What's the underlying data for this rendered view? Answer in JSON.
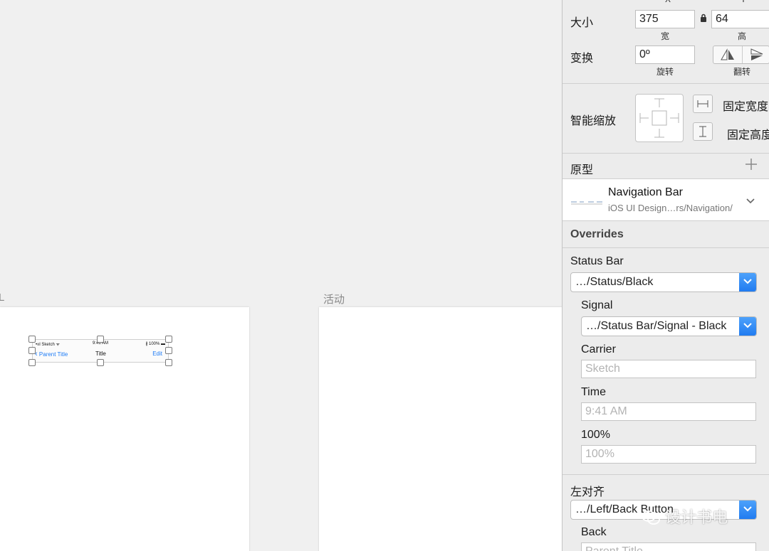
{
  "canvas": {
    "artboard_right_label": "活动",
    "artboard_left_label": "L",
    "navbar": {
      "status_left": "•ııl Sketch ᯤ",
      "status_time": "9:41 AM",
      "status_right": "∦ 100% ▬",
      "back_label": "Parent Title",
      "title": "Title",
      "edit_label": "Edit"
    }
  },
  "inspector": {
    "size": {
      "label": "大小",
      "width_value": "375",
      "width_caption": "宽",
      "height_value": "64",
      "height_caption": "高",
      "top_caption_x": "X",
      "top_caption_y": "Y"
    },
    "transform": {
      "label": "变换",
      "rotate_value": "0º",
      "rotate_caption": "旋转",
      "flip_caption": "翻转"
    },
    "resizing": {
      "label": "智能缩放",
      "fix_width_label": "固定宽度",
      "fix_height_label": "固定高度"
    },
    "symbol": {
      "section_label": "原型",
      "name": "Navigation Bar",
      "path": "iOS UI Design…rs/Navigation/"
    },
    "overrides": {
      "section_label": "Overrides",
      "status_bar_label": "Status Bar",
      "status_bar_value": "…/Status/Black",
      "signal_label": "Signal",
      "signal_value": "…/Status Bar/Signal - Black",
      "carrier_label": "Carrier",
      "carrier_placeholder": "Sketch",
      "time_label": "Time",
      "time_placeholder": "9:41 AM",
      "battery_label": "100%",
      "battery_placeholder": "100%",
      "left_label": "左对齐",
      "left_value": "…/Left/Back Button",
      "back_label": "Back",
      "back_placeholder": "Parent Title"
    }
  },
  "watermark": "设计书电",
  "colors": {
    "accent": "#1e7cf6",
    "select_chevron": "#2b85f5"
  }
}
